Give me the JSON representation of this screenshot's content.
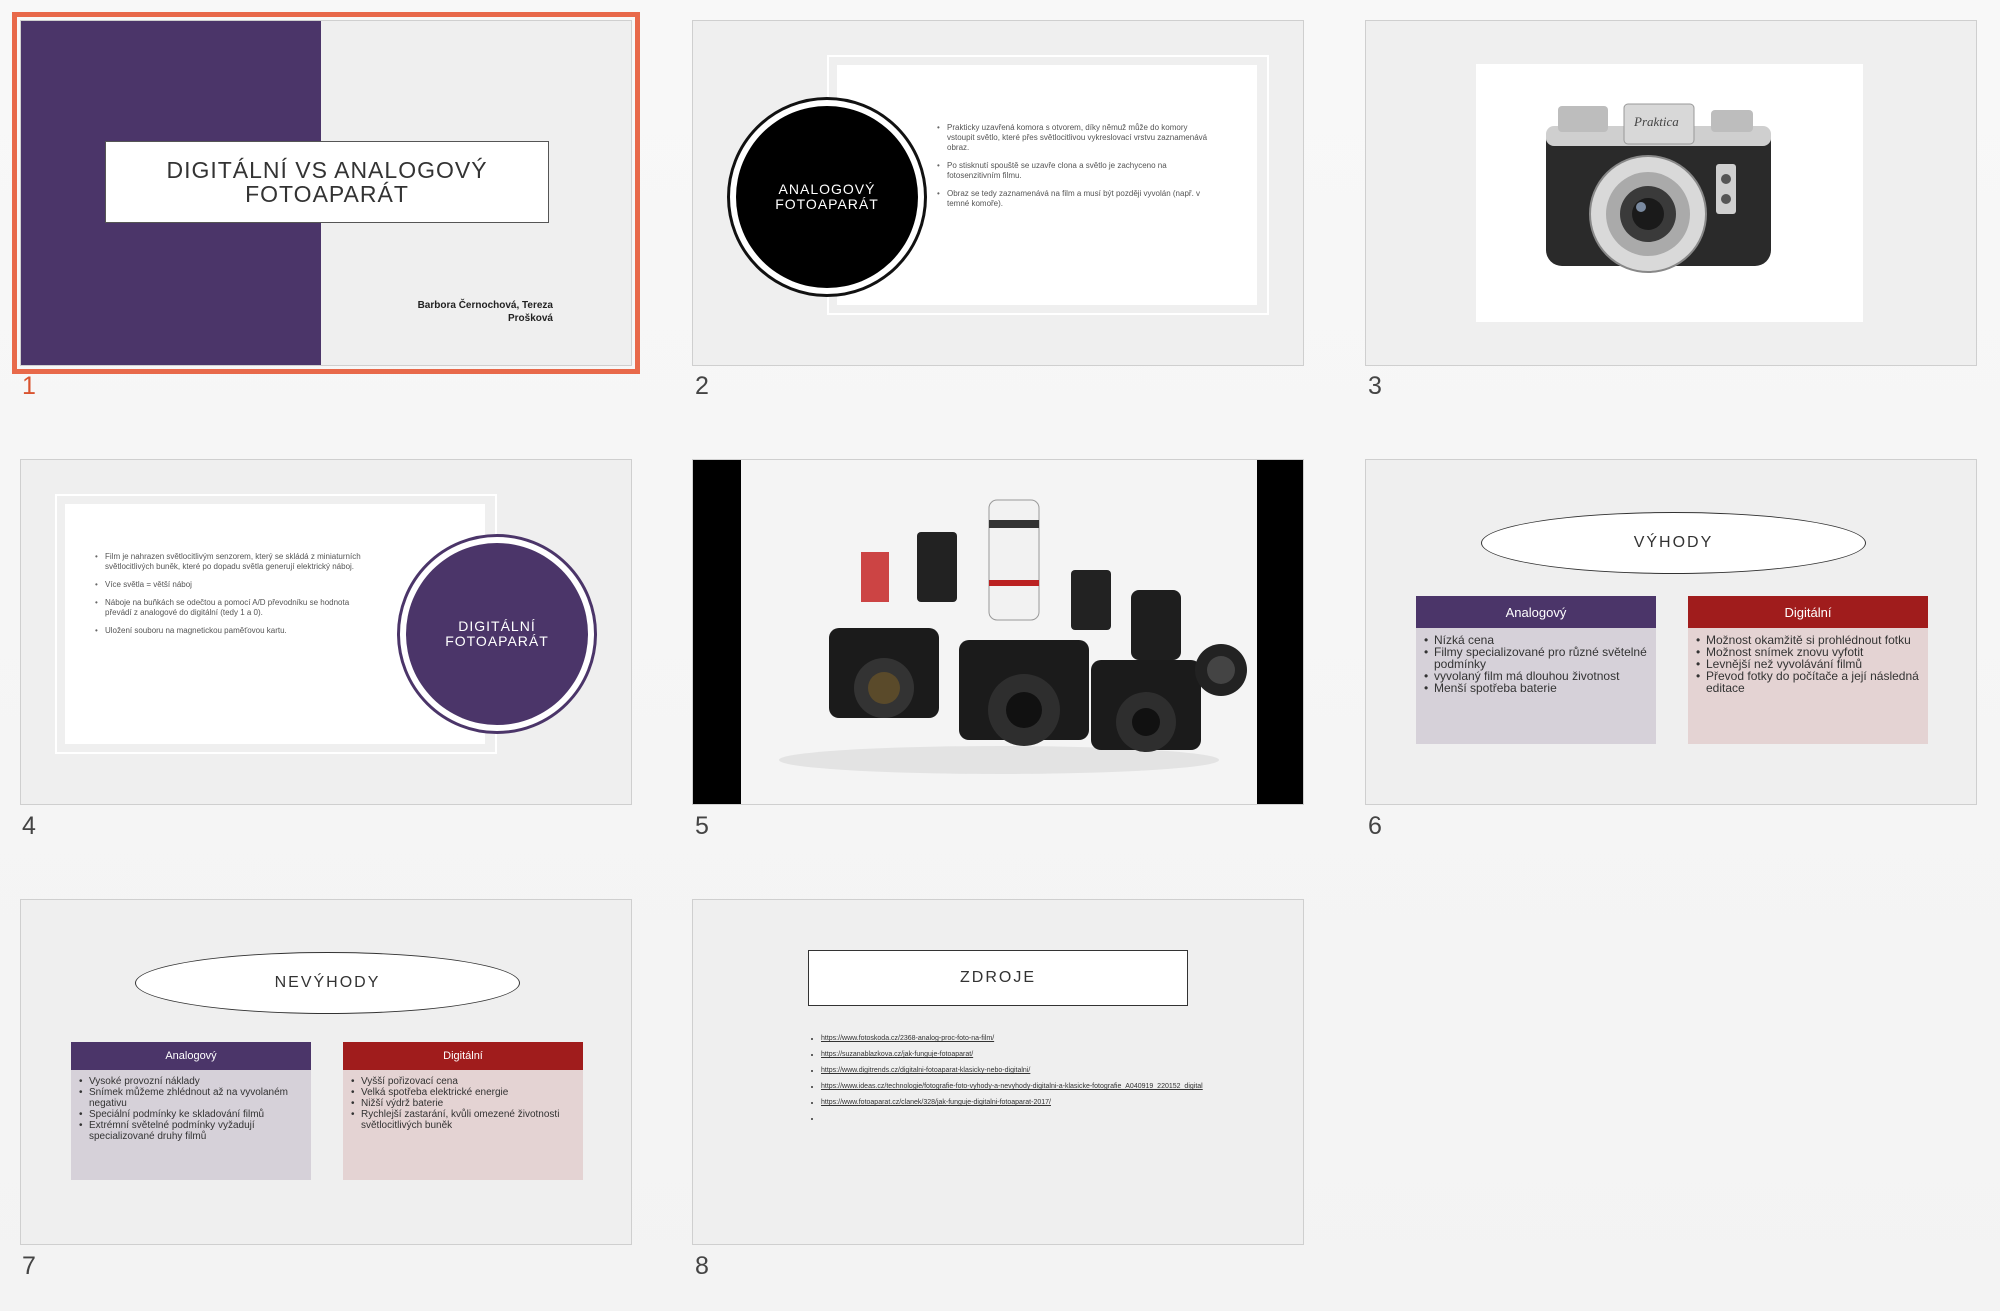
{
  "slides": [
    {
      "number": "1",
      "title": "DIGITÁLNÍ VS ANALOGOVÝ FOTOAPARÁT",
      "authors": "Barbora Černochová, Tereza Prošková"
    },
    {
      "number": "2",
      "circle_text": "ANALOGOVÝ FOTOAPARÁT",
      "bullets": [
        "Prakticky uzavřená komora s otvorem, díky němuž může do komory vstoupit světlo, které přes světlocitlivou vykreslovací vrstvu zaznamenává obraz.",
        "Po stisknutí spouště se uzavře clona a světlo je zachyceno na fotosenzitivním filmu.",
        "Obraz se tedy zaznamenává na film a musí být později vyvolán (např. v temné komoře)."
      ]
    },
    {
      "number": "3",
      "camera_brand": "Praktica"
    },
    {
      "number": "4",
      "circle_text": "DIGITÁLNÍ FOTOAPARÁT",
      "bullets": [
        "Film je nahrazen světlocitlivým senzorem, který se skládá z miniaturních světlocitlivých buněk, které po dopadu světla generují elektrický náboj.",
        "Více světla = větší náboj",
        "Náboje na buňkách se odečtou a pomocí A/D převodníku se hodnota převádí z analogové do digitální (tedy 1 a 0).",
        "Uložení souboru na magnetickou paměťovou kartu."
      ]
    },
    {
      "number": "5"
    },
    {
      "number": "6",
      "heading": "VÝHODY",
      "left": {
        "title": "Analogový",
        "items": [
          "Nízká cena",
          "Filmy specializované pro různé světelné podmínky",
          "vyvolaný film má dlouhou životnost",
          "Menší spotřeba baterie"
        ]
      },
      "right": {
        "title": "Digitální",
        "items": [
          "Možnost okamžitě si prohlédnout fotku",
          "Možnost snímek znovu vyfotit",
          "Levnější než vyvolávání filmů",
          "Převod fotky do počítače a její následná editace"
        ]
      }
    },
    {
      "number": "7",
      "heading": "NEVÝHODY",
      "left": {
        "title": "Analogový",
        "items": [
          "Vysoké provozní náklady",
          "Snímek můžeme zhlédnout až na vyvolaném negativu",
          "Speciální podmínky ke skladování filmů",
          "Extrémní světelné podmínky vyžadují specializované druhy filmů"
        ]
      },
      "right": {
        "title": "Digitální",
        "items": [
          "Vyšší pořizovací cena",
          "Velká spotřeba elektrické energie",
          "Nižší výdrž baterie",
          "Rychlejší zastarání, kvůli omezené životnosti světlocitlivých buněk"
        ]
      }
    },
    {
      "number": "8",
      "heading": "ZDROJE",
      "links": [
        "https://www.fotoskoda.cz/2368-analog-proc-foto-na-film/",
        "https://suzanablazkova.cz/jak-funguje-fotoaparat/",
        "https://www.digitrends.cz/digitalni-fotoaparat-klasicky-nebo-digitalni/",
        "https://www.ideas.cz/technologie/fotografie-foto-vyhody-a-nevyhody-digitalni-a-klasicke-fotografie_A040919_220152_digital",
        "https://www.fotoaparat.cz/clanek/328/jak-funguje-digitalni-fotoaparat-2017/",
        ""
      ]
    }
  ],
  "colors": {
    "purple": "#4b3569",
    "red": "#a01c1c",
    "selection": "#e8694a"
  }
}
